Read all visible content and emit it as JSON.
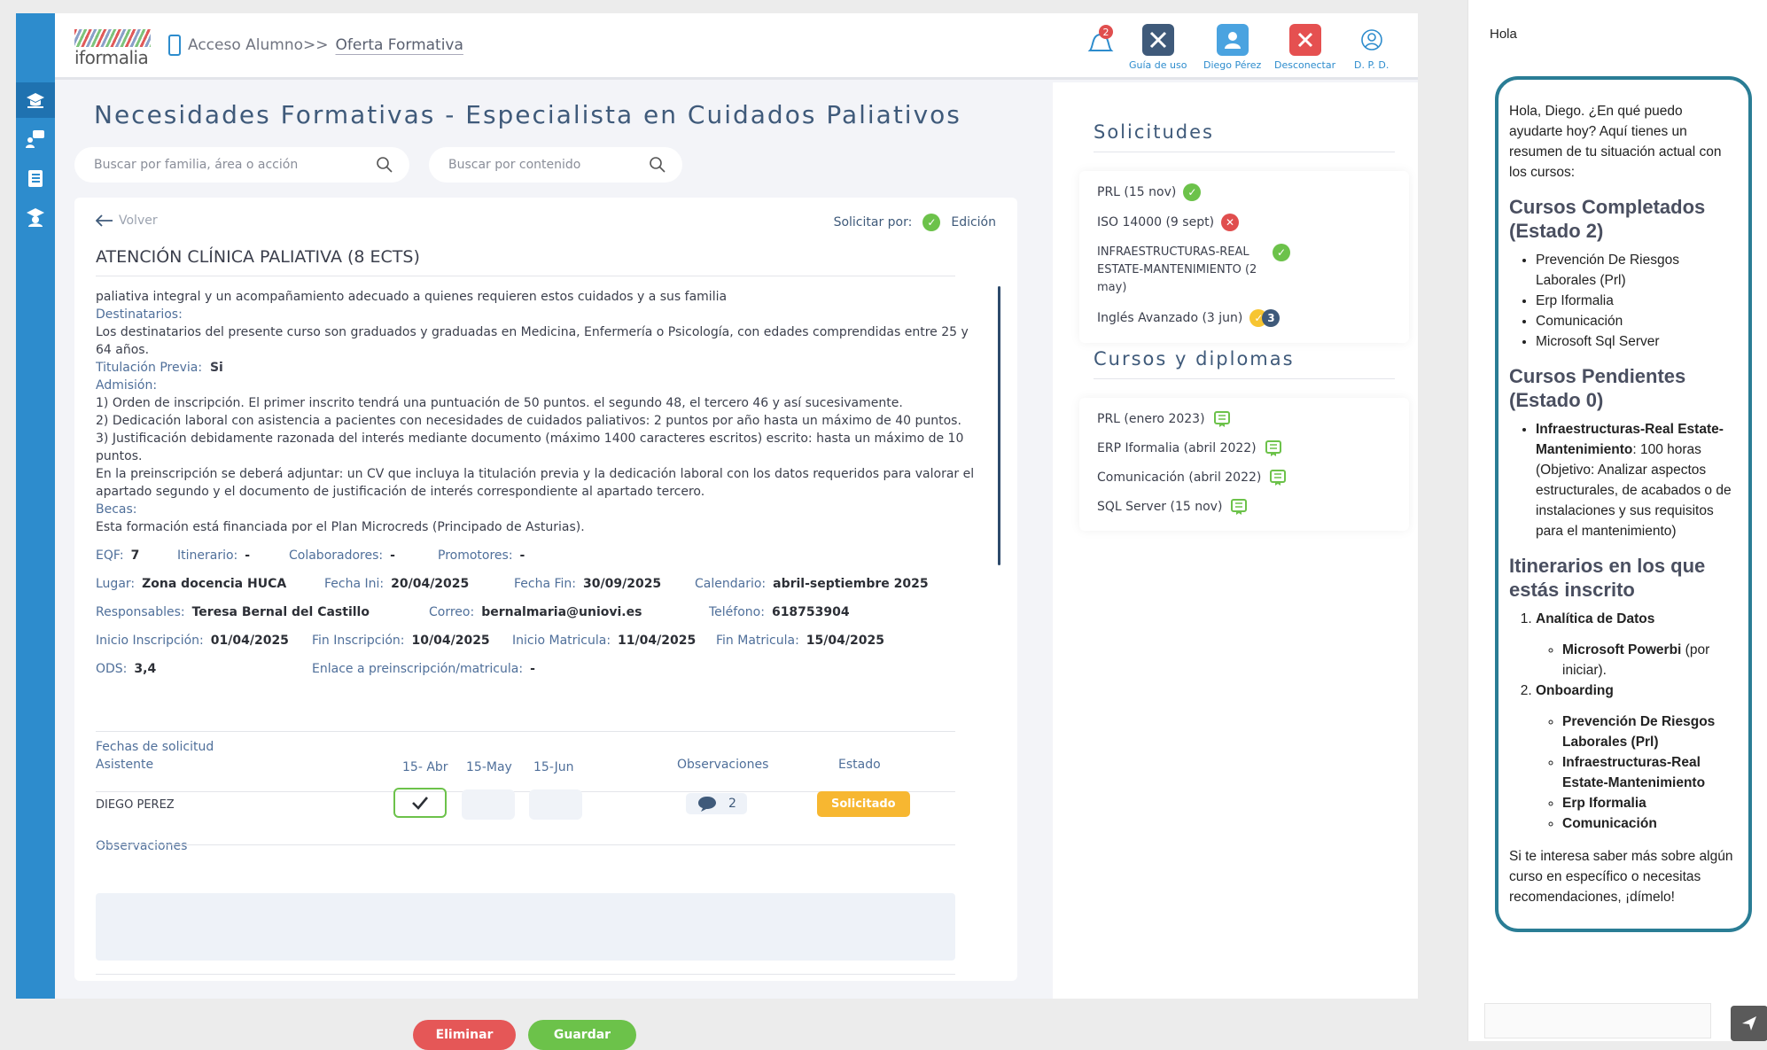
{
  "header": {
    "logo_text": "iformalia",
    "crumb_prefix": "Acceso Alumno>>",
    "crumb_link": "Oferta Formativa",
    "notif_count": "2",
    "tools": [
      {
        "label": "Guía de uso"
      },
      {
        "label": "Diego Pérez"
      },
      {
        "label": "Desconectar"
      },
      {
        "label": "D. P. D."
      }
    ]
  },
  "page": {
    "title": "Necesidades Formativas - Especialista en Cuidados Paliativos",
    "search1_placeholder": "Buscar por familia, área o acción",
    "search2_placeholder": "Buscar por contenido"
  },
  "course": {
    "back": "Volver",
    "solicitar_label": "Solicitar por:",
    "edicion": "Edición",
    "title": "ATENCIÓN CLÍNICA PALIATIVA (8 ECTS)",
    "intro": "paliativa integral y un acompañamiento adecuado a quienes requieren estos cuidados y a sus familia",
    "destinatarios_label": "Destinatarios:",
    "destinatarios": "Los destinatarios del presente curso son graduados y graduadas en Medicina, Enfermería o Psicología, con edades comprendidas entre 25 y 64 años.",
    "titulacion_label": "Titulación Previa:",
    "titulacion": "Si",
    "admision_label": "Admisión:",
    "admision": [
      "1) Orden de inscripción. El primer inscrito tendrá una puntuación de 50 puntos.  el segundo 48, el tercero 46 y así sucesivamente.",
      "2) Dedicación laboral con asistencia a pacientes con necesidades de cuidados paliativos: 2 puntos por año hasta un máximo de 40 puntos.",
      "3) Justificación debidamente razonada del interés mediante documento (máximo 1400 caracteres escritos) escrito: hasta un máximo de 10 puntos.",
      "En la preinscripción se deberá adjuntar: un CV que incluya la titulación previa y la dedicación laboral con los datos requeridos para valorar el apartado segundo y el documento de justificación de interés correspondiente al apartado tercero."
    ],
    "becas_label": "Becas:",
    "becas": "Esta formación está financiada por el Plan Microcreds (Principado de Asturias).",
    "eqf_label": "EQF:",
    "eqf": "7",
    "itinerario_label": "Itinerario:",
    "itinerario": "-",
    "colab_label": "Colaboradores:",
    "colab": "-",
    "promo_label": "Promotores:",
    "promo": "-",
    "lugar_label": "Lugar:",
    "lugar": "Zona docencia HUCA",
    "fini_label": "Fecha Ini:",
    "fini": "20/04/2025",
    "ffin_label": "Fecha Fin:",
    "ffin": "30/09/2025",
    "cal_label": "Calendario:",
    "cal": "abril-septiembre 2025",
    "resp_label": "Responsables:",
    "resp": "Teresa Bernal del Castillo",
    "correo_label": "Correo:",
    "correo": "bernalmaria@uniovi.es",
    "tel_label": "Teléfono:",
    "tel": "618753904",
    "iins_label": "Inicio Inscripción:",
    "iins": "01/04/2025",
    "fins_label": "Fin Inscripción:",
    "fins": "10/04/2025",
    "imat_label": "Inicio Matricula:",
    "imat": "11/04/2025",
    "fmat_label": "Fin Matricula:",
    "fmat": "15/04/2025",
    "ods_label": "ODS:",
    "ods": "3,4",
    "enlace_label": "Enlace a preinscripción/matricula:",
    "enlace": "-"
  },
  "fechas": {
    "title": "Fechas de solicitud",
    "col_asistente": "Asistente",
    "col_d1": "15- Abr",
    "col_d2": "15-May",
    "col_d3": "15-Jun",
    "col_obs": "Observaciones",
    "col_estado": "Estado",
    "row_name": "DIEGO PEREZ",
    "row_obs_count": "2",
    "row_estado": "Solicitado",
    "obs_label": "Observaciones"
  },
  "buttons": {
    "eliminar": "Eliminar",
    "guardar": "Guardar"
  },
  "solicitudes": {
    "title": "Solicitudes",
    "items": [
      {
        "label": "PRL (15 nov)",
        "status": "ok"
      },
      {
        "label": "ISO 14000 (9 sept)",
        "status": "ko"
      },
      {
        "label": "INFRAESTRUCTURAS-REAL ESTATE-MANTENIMIENTO (2 may)",
        "status": "ok"
      },
      {
        "label": "Inglés Avanzado (3 jun)",
        "status": "pending",
        "count": "3"
      }
    ]
  },
  "cursos": {
    "title": "Cursos y diplomas",
    "items": [
      {
        "label": "PRL  (enero 2023)"
      },
      {
        "label": "ERP Iformalia (abril 2022)"
      },
      {
        "label": "Comunicación (abril 2022)"
      },
      {
        "label": "SQL Server (15 nov)"
      }
    ]
  },
  "chat": {
    "greeting": "Hola",
    "intro": "Hola, Diego. ¿En qué puedo ayudarte hoy? Aquí tienes un resumen de tu situación actual con los cursos:",
    "h1": "Cursos Completados (Estado 2)",
    "completed": [
      "Prevención De Riesgos Laborales (Prl)",
      "Erp Iformalia",
      "Comunicación",
      "Microsoft Sql Server"
    ],
    "h2": "Cursos Pendientes (Estado 0)",
    "pending_bold": "Infraestructuras-Real Estate-Mantenimiento",
    "pending_rest": ": 100 horas (Objetivo: Analizar aspectos estructurales, de acabados o de instalaciones y sus requisitos para el mantenimiento)",
    "h3": "Itinerarios en los que estás inscrito",
    "it1": "Analítica de Datos",
    "it1_sub_bold": "Microsoft Powerbi",
    "it1_sub_rest": " (por iniciar).",
    "it2": "Onboarding",
    "it2_subs": [
      "Prevención De Riesgos Laborales (Prl)",
      "Infraestructuras-Real Estate-Mantenimiento",
      "Erp Iformalia",
      "Comunicación"
    ],
    "closing": "Si te interesa saber más sobre algún curso en específico o necesitas recomendaciones, ¡dímelo!"
  }
}
